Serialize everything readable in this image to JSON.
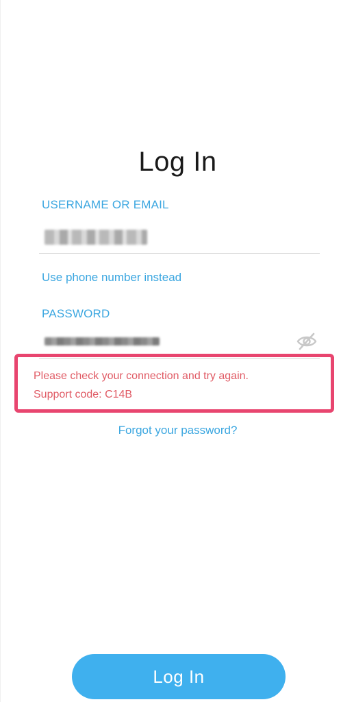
{
  "screen": {
    "title": "Log In"
  },
  "username": {
    "label": "USERNAME OR EMAIL"
  },
  "phone_link": {
    "label": "Use phone number instead"
  },
  "password": {
    "label": "PASSWORD"
  },
  "error": {
    "line1": "Please check your connection and try again.",
    "line2": "Support code: C14B"
  },
  "forgot_link": {
    "label": "Forgot your password?"
  },
  "login_button": {
    "label": "Log In"
  },
  "icons": {
    "password_toggle": "eye-slash-icon"
  },
  "colors": {
    "accent": "#3aa6e0",
    "button": "#3fb0ee",
    "error_text": "#e05a64",
    "highlight_border": "#e8456f"
  }
}
